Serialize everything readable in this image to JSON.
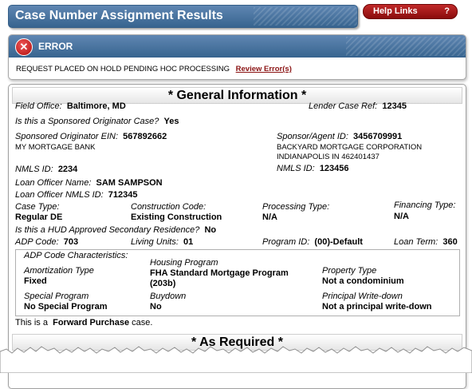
{
  "header": {
    "title": "Case Number Assignment Results",
    "help_label": "Help Links",
    "help_icon": "?"
  },
  "error": {
    "icon": "x-circle-icon",
    "title": "ERROR",
    "message": "REQUEST PLACED ON HOLD PENDING HOC PROCESSING",
    "link": "Review Error(s)"
  },
  "general": {
    "heading": "* General Information *",
    "field_office_label": "Field Office:",
    "field_office_value": "Baltimore, MD",
    "lender_case_ref_label": "Lender Case Ref:",
    "lender_case_ref_value": "12345",
    "sponsored_orig_label": "Is this a Sponsored Originator Case?",
    "sponsored_orig_value": "Yes",
    "sponsored_ein_label": "Sponsored Originator EIN:",
    "sponsored_ein_value": "567892662",
    "sponsored_name": "MY MORTGAGE BANK",
    "sponsor_agent_label": "Sponsor/Agent ID:",
    "sponsor_agent_value": "3456709991",
    "sponsor_name": "BACKYARD MORTGAGE CORPORATION",
    "sponsor_city": "INDIANAPOLIS IN 462401437",
    "nmls_left_label": "NMLS ID:",
    "nmls_left_value": "2234",
    "nmls_right_label": "NMLS ID:",
    "nmls_right_value": "123456",
    "loan_officer_label": "Loan Officer Name:",
    "loan_officer_value": "SAM SAMPSON",
    "lo_nmls_label": "Loan Officer NMLS ID:",
    "lo_nmls_value": "712345",
    "case_type_label": "Case Type:",
    "case_type_value": "Regular DE",
    "construction_label": "Construction Code:",
    "construction_value": "Existing Construction",
    "processing_label": "Processing Type:",
    "processing_value": "N/A",
    "financing_label": "Financing Type:",
    "financing_value": "N/A",
    "hud_secondary_label": "Is this a HUD Approved Secondary Residence?",
    "hud_secondary_value": "No",
    "adp_code_label": "ADP Code:",
    "adp_code_value": "703",
    "living_units_label": "Living Units:",
    "living_units_value": "01",
    "program_id_label": "Program ID:",
    "program_id_value": "(00)-Default",
    "loan_term_label": "Loan Term:",
    "loan_term_value": "360"
  },
  "adp": {
    "title": "ADP Code Characteristics:",
    "amort_label": "Amortization Type",
    "amort_value": "Fixed",
    "housing_label": "Housing Program",
    "housing_value_1": "FHA Standard Mortgage Program",
    "housing_value_2": "(203b)",
    "property_label": "Property Type",
    "property_value": "Not a condominium",
    "special_label": "Special Program",
    "special_value": "No Special Program",
    "buydown_label": "Buydown",
    "buydown_value": "No",
    "principal_label": "Principal Write-down",
    "principal_value": "Not a principal write-down"
  },
  "purchase": {
    "prefix": "This is a",
    "type": "Forward Purchase",
    "suffix": "case."
  },
  "as_required": {
    "heading": "* As Required *"
  }
}
